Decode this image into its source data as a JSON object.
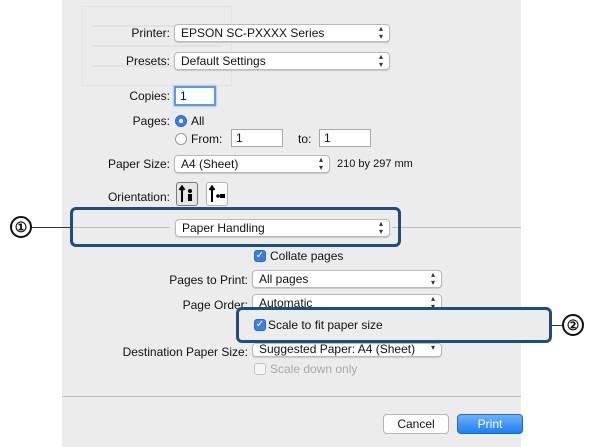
{
  "printer": {
    "label": "Printer:",
    "value": "EPSON SC-PXXXX Series"
  },
  "presets": {
    "label": "Presets:",
    "value": "Default Settings"
  },
  "copies": {
    "label": "Copies:",
    "value": "1"
  },
  "pages": {
    "label": "Pages:",
    "all_label": "All",
    "from_label": "From:",
    "from_value": "1",
    "to_label": "to:",
    "to_value": "1",
    "selected": "All"
  },
  "paper_size": {
    "label": "Paper Size:",
    "value": "A4 (Sheet)",
    "dimensions": "210 by 297 mm"
  },
  "orientation": {
    "label": "Orientation:",
    "selected": "portrait"
  },
  "panel_select": {
    "value": "Paper Handling"
  },
  "collate": {
    "label": "Collate pages",
    "checked": true
  },
  "pages_to_print": {
    "label": "Pages to Print:",
    "value": "All pages"
  },
  "page_order": {
    "label": "Page Order:",
    "value": "Automatic"
  },
  "scale_to_fit": {
    "label": "Scale to fit paper size",
    "checked": true
  },
  "destination": {
    "label": "Destination Paper Size:",
    "value": "Suggested Paper: A4 (Sheet)"
  },
  "scale_down": {
    "label": "Scale down only",
    "checked": false,
    "enabled": false
  },
  "buttons": {
    "cancel": "Cancel",
    "print": "Print"
  },
  "callouts": {
    "one": "①",
    "two": "②"
  },
  "colors": {
    "callout_border": "#1d4f7a",
    "accent": "#3b7fe3",
    "print_button": "#1f7cf5"
  }
}
